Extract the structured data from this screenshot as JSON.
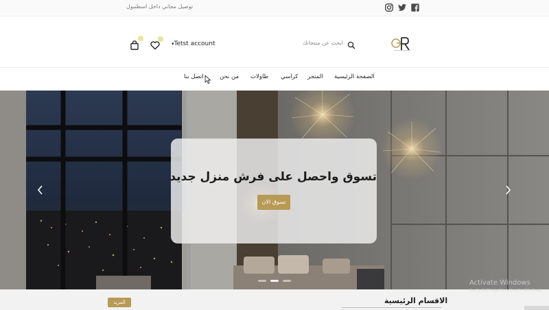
{
  "top_bar": {
    "notice": "توصيل مجاني داخل اسطنبول",
    "social_icons": [
      "instagram-icon",
      "twitter-icon",
      "facebook-icon"
    ]
  },
  "header": {
    "logo_text": "GR",
    "search_placeholder": "ابحث عن منتجاتك",
    "account_label": "Tetst account",
    "account_caret": "▾"
  },
  "nav": {
    "items": [
      {
        "label": "الصفحة الرئيسية"
      },
      {
        "label": "المتجر"
      },
      {
        "label": "كراسي"
      },
      {
        "label": "طاولات"
      },
      {
        "label": "من نحن"
      },
      {
        "label": "اتصل بنا"
      }
    ]
  },
  "hero": {
    "headline": "تسوق واحصل على فرش منزل جديد",
    "cta_label": "تسوق الان",
    "slide_count": 3,
    "active_slide": 1
  },
  "sections": {
    "main_categories_title": "الاقسام الرئيسية",
    "more_label": "المزيد"
  },
  "watermark": {
    "line1": "Activate Windows",
    "line2": "Go to Settings to activate Windows."
  },
  "colors": {
    "accent_gold": "#b79a55",
    "badge_yellow": "#eae39a",
    "text_dark": "#1c1c1c"
  }
}
